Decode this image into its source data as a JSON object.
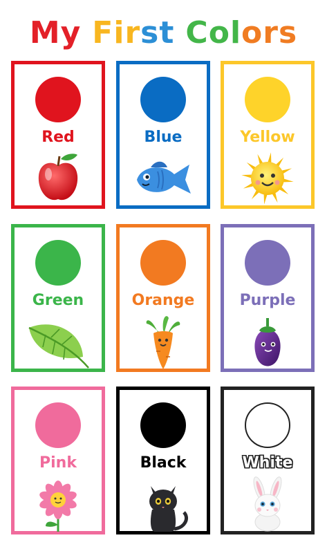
{
  "title": {
    "words": [
      {
        "letters": [
          {
            "ch": "M",
            "color": "#e32028"
          },
          {
            "ch": "y",
            "color": "#e32028"
          }
        ]
      },
      {
        "letters": [
          {
            "ch": "F",
            "color": "#f8b620"
          },
          {
            "ch": "i",
            "color": "#f8b620"
          },
          {
            "ch": "r",
            "color": "#f8b620"
          },
          {
            "ch": "s",
            "color": "#2c8fd6"
          },
          {
            "ch": "t",
            "color": "#2c8fd6"
          }
        ]
      },
      {
        "letters": [
          {
            "ch": "C",
            "color": "#43b649"
          },
          {
            "ch": "o",
            "color": "#43b649"
          },
          {
            "ch": "l",
            "color": "#43b649"
          },
          {
            "ch": "o",
            "color": "#f07c22"
          },
          {
            "ch": "r",
            "color": "#f07c22"
          },
          {
            "ch": "s",
            "color": "#f07c22"
          }
        ]
      }
    ]
  },
  "cards": [
    {
      "label": "Red",
      "color": "#e0141e",
      "border": "#e0141e",
      "text_color": "#e0141e",
      "icon": "apple-icon"
    },
    {
      "label": "Blue",
      "color": "#0a6cc3",
      "border": "#0a6cc3",
      "text_color": "#0a6cc3",
      "icon": "fish-icon"
    },
    {
      "label": "Yellow",
      "color": "#fed32a",
      "border": "#fcc72a",
      "text_color": "#fcc72a",
      "icon": "sun-icon"
    },
    {
      "label": "Green",
      "color": "#3bb54a",
      "border": "#3bb54a",
      "text_color": "#3bb54a",
      "icon": "leaf-icon"
    },
    {
      "label": "Orange",
      "color": "#f27a21",
      "border": "#f27a21",
      "text_color": "#f27a21",
      "icon": "carrot-icon"
    },
    {
      "label": "Purple",
      "color": "#7c6fb8",
      "border": "#7c6fb8",
      "text_color": "#7c6fb8",
      "icon": "eggplant-icon"
    },
    {
      "label": "Pink",
      "color": "#f06b9c",
      "border": "#f06b9c",
      "text_color": "#f06b9c",
      "icon": "flower-icon"
    },
    {
      "label": "Black",
      "color": "#000000",
      "border": "#000000",
      "text_color": "#000000",
      "icon": "cat-icon"
    },
    {
      "label": "White",
      "color": "#ffffff",
      "border": "#222222",
      "text_color": "#ffffff",
      "icon": "bunny-icon"
    }
  ]
}
